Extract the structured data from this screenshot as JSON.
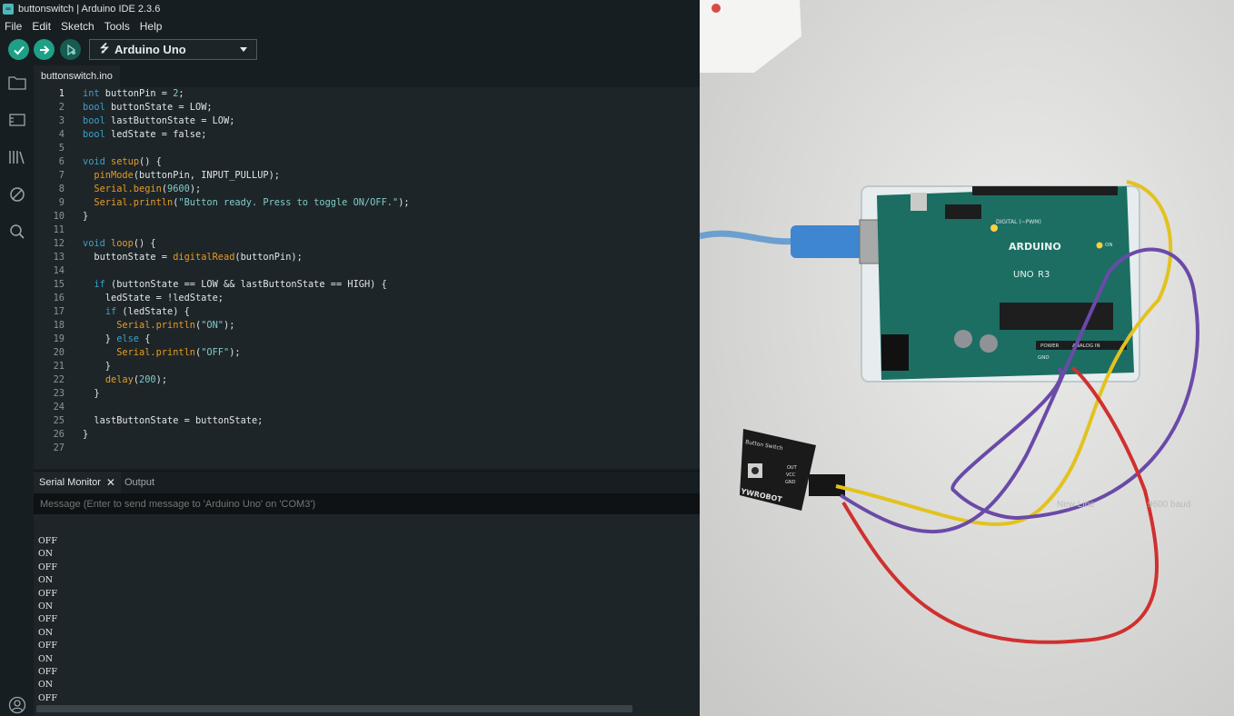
{
  "window": {
    "title": "buttonswitch | Arduino IDE 2.3.6"
  },
  "menu": [
    "File",
    "Edit",
    "Sketch",
    "Tools",
    "Help"
  ],
  "toolbar": {
    "board": "Arduino Uno"
  },
  "editor": {
    "file_tab": "buttonswitch.ino",
    "lines": [
      {
        "n": "1",
        "code": "int buttonPin = 2;"
      },
      {
        "n": "2",
        "code": "bool buttonState = LOW;"
      },
      {
        "n": "3",
        "code": "bool lastButtonState = LOW;"
      },
      {
        "n": "4",
        "code": "bool ledState = false;"
      },
      {
        "n": "5",
        "code": ""
      },
      {
        "n": "6",
        "code": "void setup() {"
      },
      {
        "n": "7",
        "code": "  pinMode(buttonPin, INPUT_PULLUP);"
      },
      {
        "n": "8",
        "code": "  Serial.begin(9600);"
      },
      {
        "n": "9",
        "code": "  Serial.println(\"Button ready. Press to toggle ON/OFF.\");"
      },
      {
        "n": "10",
        "code": "}"
      },
      {
        "n": "11",
        "code": ""
      },
      {
        "n": "12",
        "code": "void loop() {"
      },
      {
        "n": "13",
        "code": "  buttonState = digitalRead(buttonPin);"
      },
      {
        "n": "14",
        "code": ""
      },
      {
        "n": "15",
        "code": "  if (buttonState == LOW && lastButtonState == HIGH) {"
      },
      {
        "n": "16",
        "code": "    ledState = !ledState;"
      },
      {
        "n": "17",
        "code": "    if (ledState) {"
      },
      {
        "n": "18",
        "code": "      Serial.println(\"ON\");"
      },
      {
        "n": "19",
        "code": "    } else {"
      },
      {
        "n": "20",
        "code": "      Serial.println(\"OFF\");"
      },
      {
        "n": "21",
        "code": "    }"
      },
      {
        "n": "22",
        "code": "    delay(200);"
      },
      {
        "n": "23",
        "code": "  }"
      },
      {
        "n": "24",
        "code": ""
      },
      {
        "n": "25",
        "code": "  lastButtonState = buttonState;"
      },
      {
        "n": "26",
        "code": "}"
      },
      {
        "n": "27",
        "code": ""
      }
    ]
  },
  "panel": {
    "tab_serial": "Serial Monitor",
    "tab_output": "Output",
    "input_placeholder": "Message (Enter to send message to 'Arduino Uno' on 'COM3')",
    "line_ending": "New Line",
    "baud": "9600 baud",
    "output_lines": [
      "OFF",
      "ON",
      "OFF",
      "ON",
      "OFF",
      "ON",
      "OFF",
      "ON",
      "OFF",
      "ON",
      "OFF",
      "ON",
      "OFF"
    ]
  },
  "photo": {
    "board_labels": [
      "ARDUINO",
      "UNO",
      "R3",
      "DIGITAL (~PWM)",
      "POWER",
      "ANALOG IN",
      "ON",
      "GND"
    ],
    "module_labels": [
      "Button Switch",
      "YWROBOT",
      "OUT",
      "VCC",
      "GND"
    ]
  }
}
